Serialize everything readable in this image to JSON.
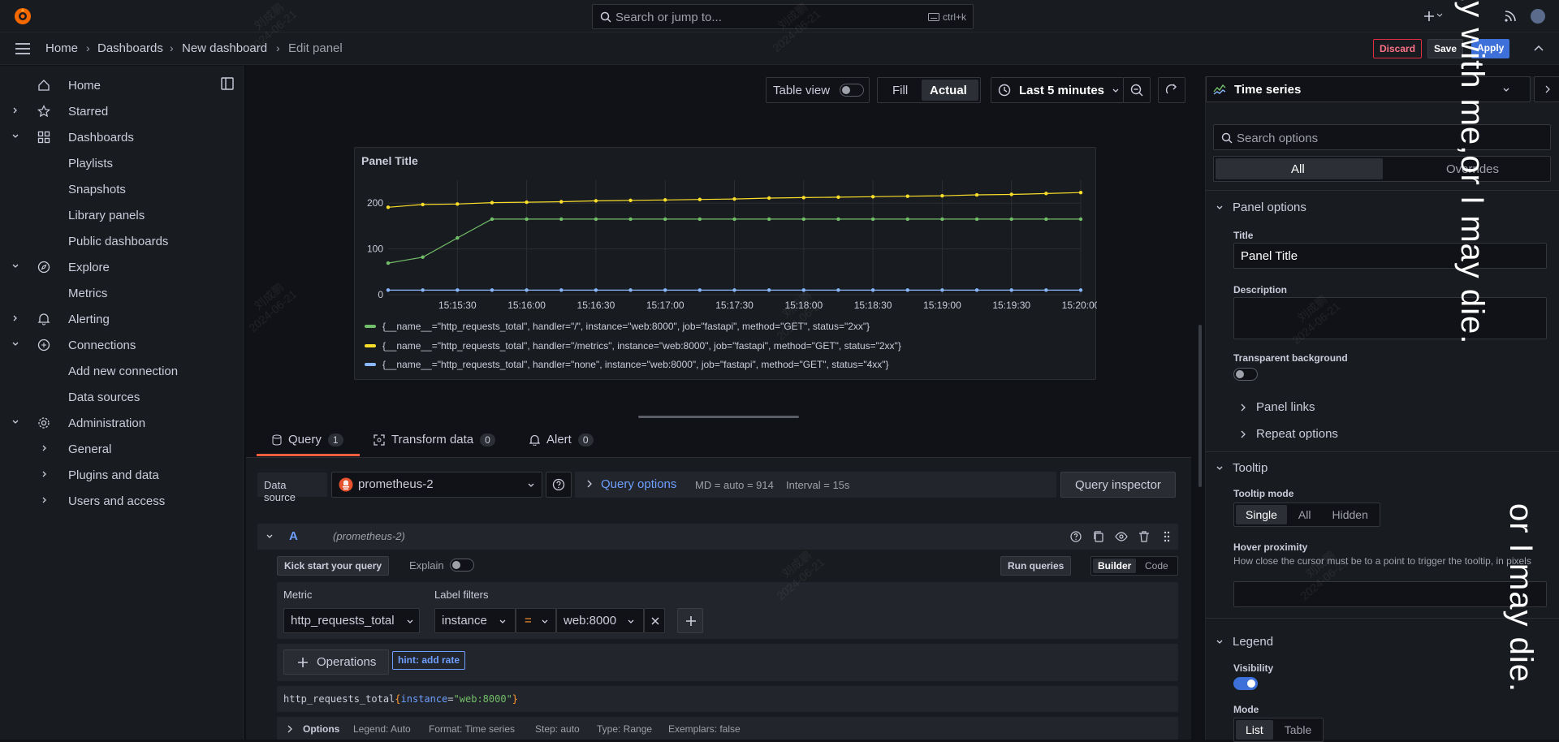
{
  "topbar": {
    "search_placeholder": "Search or jump to...",
    "search_shortcut": "ctrl+k"
  },
  "breadcrumb": [
    "Home",
    "Dashboards",
    "New dashboard",
    "Edit panel"
  ],
  "actions": {
    "discard": "Discard",
    "save": "Save",
    "apply": "Apply"
  },
  "sidebar": {
    "items": [
      {
        "label": "Home",
        "icon": "home-icon",
        "level": 0
      },
      {
        "label": "Starred",
        "icon": "star-icon",
        "level": 0,
        "chevron": "right"
      },
      {
        "label": "Dashboards",
        "icon": "grid-icon",
        "level": 0,
        "chevron": "down"
      },
      {
        "label": "Playlists",
        "level": 1
      },
      {
        "label": "Snapshots",
        "level": 1
      },
      {
        "label": "Library panels",
        "level": 1
      },
      {
        "label": "Public dashboards",
        "level": 1
      },
      {
        "label": "Explore",
        "icon": "compass-icon",
        "level": 0,
        "chevron": "down"
      },
      {
        "label": "Metrics",
        "level": 1
      },
      {
        "label": "Alerting",
        "icon": "bell-icon",
        "level": 0,
        "chevron": "right"
      },
      {
        "label": "Connections",
        "icon": "connections-icon",
        "level": 0,
        "chevron": "down"
      },
      {
        "label": "Add new connection",
        "level": 1
      },
      {
        "label": "Data sources",
        "level": 1
      },
      {
        "label": "Administration",
        "icon": "gear-icon",
        "level": 0,
        "chevron": "down"
      },
      {
        "label": "General",
        "level": 1,
        "chevron": "right"
      },
      {
        "label": "Plugins and data",
        "level": 1,
        "chevron": "right"
      },
      {
        "label": "Users and access",
        "level": 1,
        "chevron": "right"
      }
    ]
  },
  "toolbar": {
    "table_view": "Table view",
    "fill": "Fill",
    "actual": "Actual",
    "time_range": "Last 5 minutes"
  },
  "panel": {
    "title": "Panel Title",
    "chart_data": {
      "type": "line",
      "title": "Panel Title",
      "x": [
        "15:15:00",
        "15:15:15",
        "15:15:30",
        "15:15:45",
        "15:16:00",
        "15:16:15",
        "15:16:30",
        "15:16:45",
        "15:17:00",
        "15:17:15",
        "15:17:30",
        "15:17:45",
        "15:18:00",
        "15:18:15",
        "15:18:30",
        "15:18:45",
        "15:19:00",
        "15:19:15",
        "15:19:30",
        "15:19:45",
        "15:20:00"
      ],
      "x_ticks": [
        "15:15:30",
        "15:16:00",
        "15:16:30",
        "15:17:00",
        "15:17:30",
        "15:18:00",
        "15:18:30",
        "15:19:00",
        "15:19:30",
        "15:20:00"
      ],
      "y_ticks": [
        "0",
        "100",
        "200"
      ],
      "ylim": [
        0,
        250
      ],
      "grid": true,
      "legend_position": "bottom",
      "series": [
        {
          "name": "{__name__=\"http_requests_total\", handler=\"/\", instance=\"web:8000\", job=\"fastapi\", method=\"GET\", status=\"2xx\"}",
          "color": "#73bf69",
          "values": [
            69,
            82,
            124,
            165,
            165,
            165,
            165,
            165,
            165,
            165,
            165,
            165,
            165,
            165,
            165,
            165,
            165,
            165,
            165,
            165,
            165
          ]
        },
        {
          "name": "{__name__=\"http_requests_total\", handler=\"/metrics\", instance=\"web:8000\", job=\"fastapi\", method=\"GET\", status=\"2xx\"}",
          "color": "#fade2a",
          "values": [
            191,
            197,
            198,
            201,
            202,
            203,
            205,
            206,
            207,
            208,
            209,
            211,
            212,
            213,
            214,
            215,
            216,
            218,
            219,
            221,
            223
          ]
        },
        {
          "name": "{__name__=\"http_requests_total\", handler=\"none\", instance=\"web:8000\", job=\"fastapi\", method=\"GET\", status=\"4xx\"}",
          "color": "#8ab8ff",
          "values": [
            10,
            10,
            10,
            10,
            10,
            10,
            10,
            10,
            10,
            10,
            10,
            10,
            10,
            10,
            10,
            10,
            10,
            10,
            10,
            10,
            10
          ]
        }
      ]
    }
  },
  "tabs": [
    {
      "label": "Query",
      "count": "1"
    },
    {
      "label": "Transform data",
      "count": "0"
    },
    {
      "label": "Alert",
      "count": "0"
    }
  ],
  "query": {
    "data_source_label": "Data source",
    "data_source": "prometheus-2",
    "query_options": "Query options",
    "md": "MD = auto = 914",
    "interval": "Interval = 15s",
    "inspector": "Query inspector",
    "ref_id": "A",
    "ref_ds": "(prometheus-2)",
    "kick_start": "Kick start your query",
    "explain": "Explain",
    "run": "Run queries",
    "builder": "Builder",
    "code": "Code",
    "metric_label": "Metric",
    "metric": "http_requests_total",
    "label_filters": "Label filters",
    "filter_key": "instance",
    "filter_op": "=",
    "filter_value": "web:8000",
    "operations": "Operations",
    "hint": "hint: add rate",
    "code_metric": "http_requests_total",
    "code_brace_open": "{",
    "code_key": "instance",
    "code_eq": "=",
    "code_val": "\"web:8000\"",
    "code_brace_close": "}",
    "options_label": "Options",
    "opt_legend": "Legend: Auto",
    "opt_format": "Format: Time series",
    "opt_step": "Step: auto",
    "opt_type": "Type: Range",
    "opt_exemplars": "Exemplars: false"
  },
  "options": {
    "viz": "Time series",
    "search_placeholder": "Search options",
    "all": "All",
    "overrides": "Overrides",
    "panel_options": "Panel options",
    "title_label": "Title",
    "title_value": "Panel Title",
    "description_label": "Description",
    "transparent_label": "Transparent background",
    "panel_links": "Panel links",
    "repeat_options": "Repeat options",
    "tooltip": "Tooltip",
    "tooltip_mode": "Tooltip mode",
    "mode_single": "Single",
    "mode_all": "All",
    "mode_hidden": "Hidden",
    "hover_proximity": "Hover proximity",
    "hover_desc": "How close the cursor must be to a point to trigger the tooltip, in pixels",
    "legend": "Legend",
    "visibility": "Visibility",
    "mode": "Mode",
    "mode_list": "List",
    "mode_table": "Table"
  },
  "watermark": {
    "name": "刘成鹏",
    "date": "2024-06-21"
  },
  "overlay": {
    "text1": "ay with me,or I may die.",
    "text2": "or I may die."
  }
}
